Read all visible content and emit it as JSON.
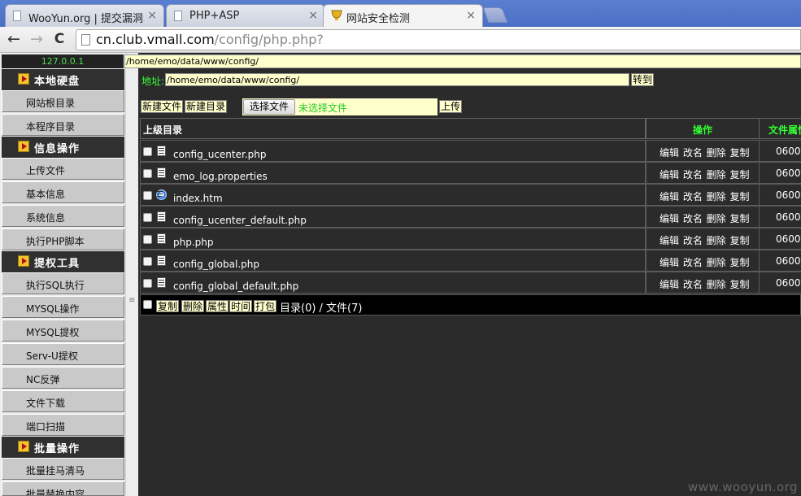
{
  "browser": {
    "tabs": [
      {
        "label": "WooYun.org | 提交漏洞",
        "close": "×",
        "active": false
      },
      {
        "label": "PHP+ASP",
        "close": "×",
        "active": false
      },
      {
        "label": "网站安全检测",
        "close": "×",
        "active": true
      }
    ],
    "url_host": "cn.club.vmall.com",
    "url_path": "/config/php.php?",
    "nav": {
      "back": "←",
      "forward": "→",
      "reload": "C"
    }
  },
  "sidebar": {
    "ip": "127.0.0.1",
    "sections": [
      {
        "title": "本地硬盘",
        "items": [
          "网站根目录",
          "本程序目录"
        ]
      },
      {
        "title": "信息操作",
        "items": [
          "上传文件",
          "基本信息",
          "系统信息",
          "执行PHP脚本"
        ]
      },
      {
        "title": "提权工具",
        "items": [
          "执行SQL执行",
          "MYSQL操作",
          "MYSQL提权",
          "Serv-U提权",
          "NC反弹",
          "文件下载",
          "端口扫描"
        ]
      },
      {
        "title": "批量操作",
        "items": [
          "批量挂马清马",
          "批量替换内容"
        ]
      }
    ]
  },
  "main": {
    "path_display": "/home/emo/data/www/config/",
    "address_label": "地址:",
    "address_value": "/home/emo/data/www/config/",
    "goto_button": "转到",
    "new_file_button": "新建文件",
    "new_dir_button": "新建目录",
    "choose_file_button": "选择文件",
    "no_file_text": "未选择文件",
    "upload_button": "上传",
    "table": {
      "col_parent": "上级目录",
      "col_ops": "操作",
      "col_attr": "文件属性",
      "rows": [
        {
          "name": "config_ucenter.php",
          "icon": "text-file-icon",
          "ops": "编辑 改名 删除 复制",
          "perm": "0600"
        },
        {
          "name": "emo_log.properties",
          "icon": "text-file-icon",
          "ops": "编辑 改名 删除 复制",
          "perm": "0600"
        },
        {
          "name": "index.htm",
          "icon": "ie-html-icon",
          "ops": "编辑 改名 删除 复制",
          "perm": "0600"
        },
        {
          "name": "config_ucenter_default.php",
          "icon": "text-file-icon",
          "ops": "编辑 改名 删除 复制",
          "perm": "0600"
        },
        {
          "name": "php.php",
          "icon": "text-file-icon",
          "ops": "编辑 改名 删除 复制",
          "perm": "0600"
        },
        {
          "name": "config_global.php",
          "icon": "text-file-icon",
          "ops": "编辑 改名 删除 复制",
          "perm": "0600"
        },
        {
          "name": "config_global_default.php",
          "icon": "text-file-icon",
          "ops": "编辑 改名 删除 复制",
          "perm": "0600"
        }
      ]
    },
    "footer": {
      "buttons": [
        "复制",
        "删除",
        "属性",
        "时间",
        "打包"
      ],
      "status": "目录(0) / 文件(7)"
    }
  },
  "watermark": "www.wooyun.org",
  "colors": {
    "accent_green": "#33ff33",
    "input_bg": "#ffffcc",
    "panel_bg": "#2b2b2b"
  }
}
